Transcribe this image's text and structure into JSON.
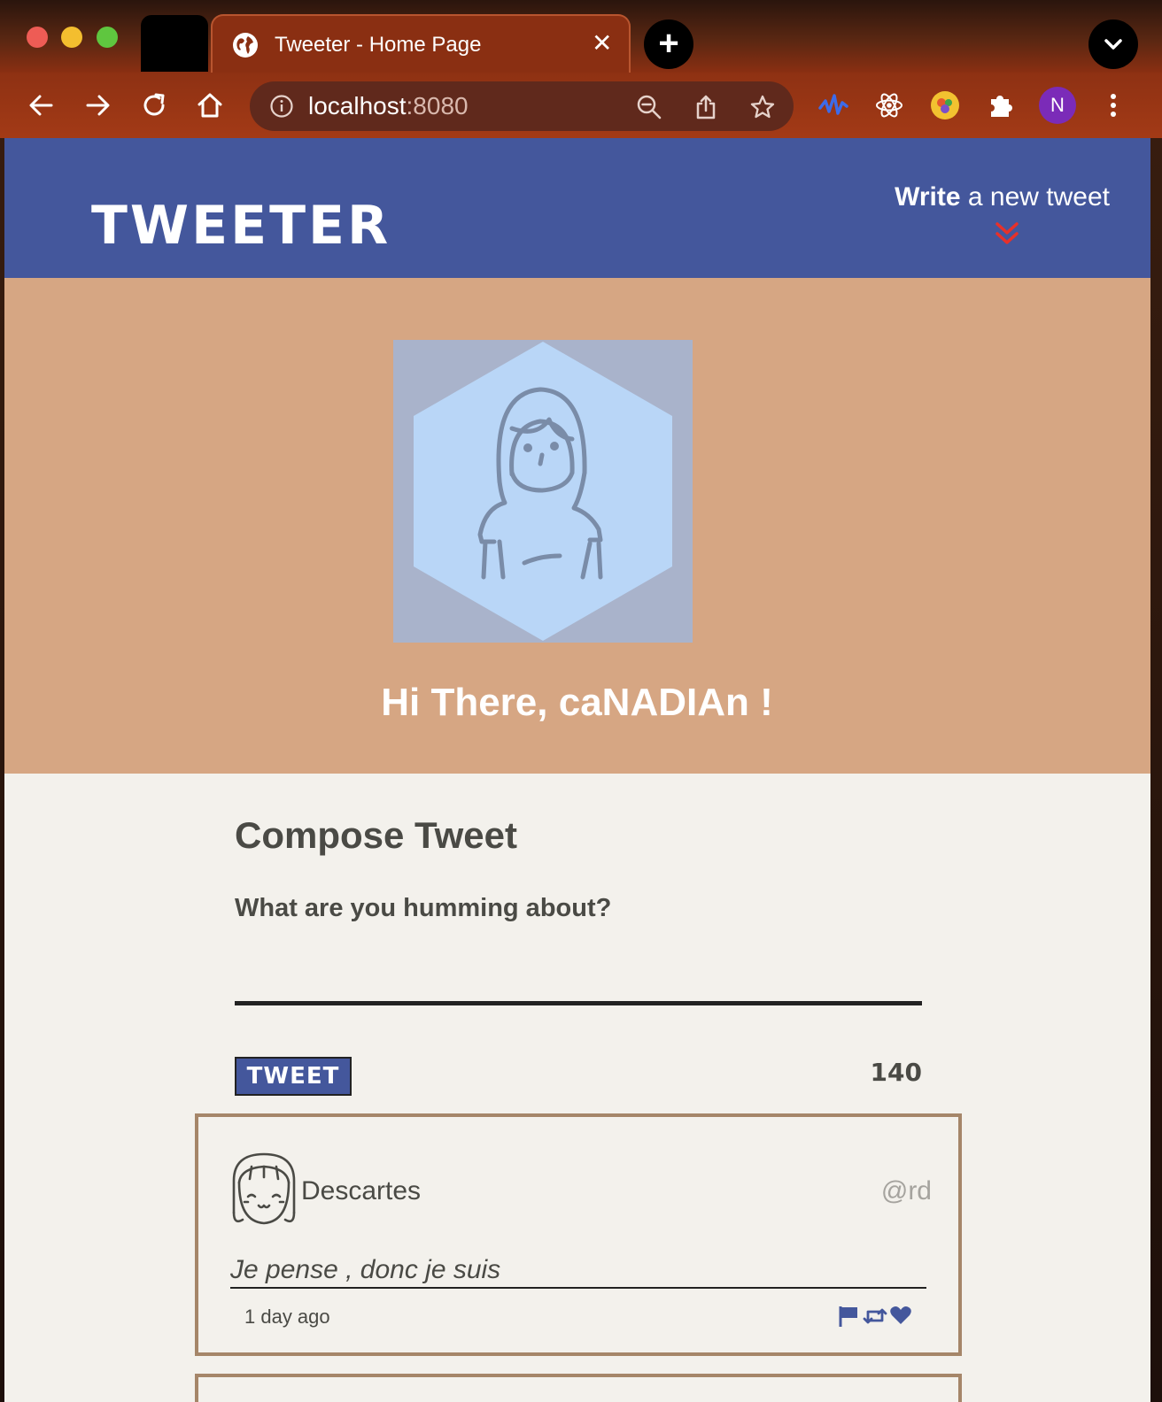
{
  "browser": {
    "tab_title": "Tweeter - Home Page",
    "tab_close": "✕",
    "new_tab": "+",
    "url_host": "localhost",
    "url_port": ":8080",
    "profile_initial": "N",
    "profile_color": "#7b2bb8"
  },
  "nav": {
    "logo": "TWEETER",
    "write_bold": "Write",
    "write_rest": " a new tweet",
    "chevron_color": "#e8312a"
  },
  "profile": {
    "greeting": "Hi There, caNADIAn !"
  },
  "compose": {
    "title": "Compose Tweet",
    "label": "What are you humming about?",
    "input_value": "",
    "button_label": "TWEET",
    "counter": "140"
  },
  "tweets": [
    {
      "name": "Descartes",
      "handle": "@rd",
      "text": "Je pense , donc je suis",
      "time": "1 day ago",
      "actions": [
        "flag-icon",
        "retweet-icon",
        "heart-icon"
      ]
    }
  ],
  "colors": {
    "nav_bg": "#44579c",
    "header_bg": "#d6a683",
    "card_border": "#a58669",
    "page_bg": "#f3f1ec"
  }
}
